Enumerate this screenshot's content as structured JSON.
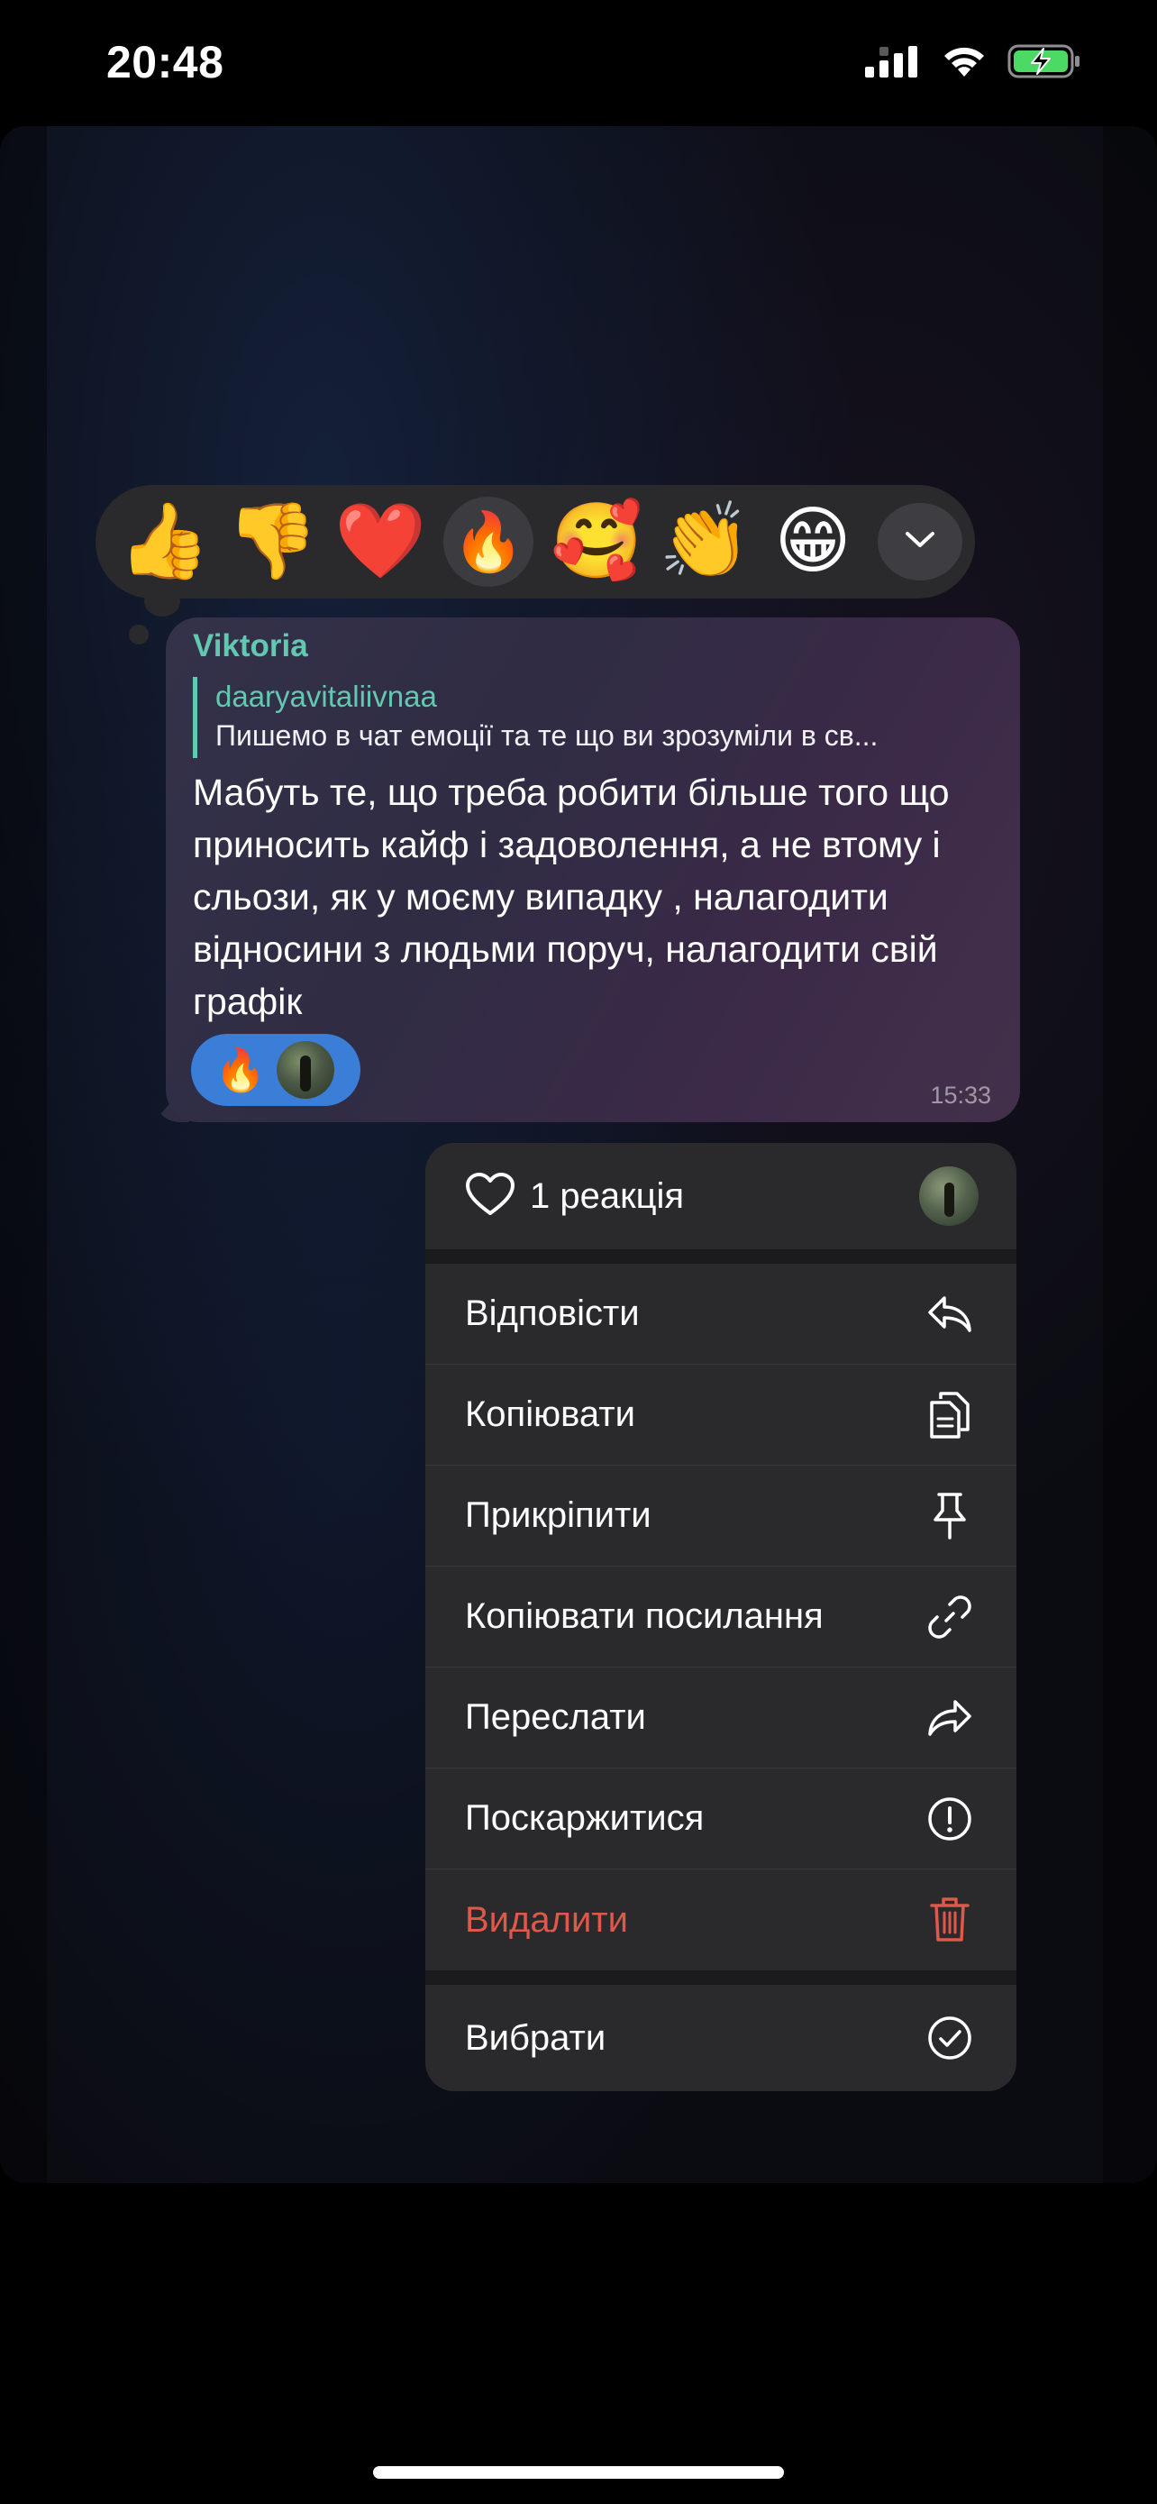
{
  "status_bar": {
    "time": "20:48",
    "signal_icon": "cellular-signal-icon",
    "wifi_icon": "wifi-icon",
    "battery_icon": "battery-charging-icon",
    "battery_color": "#4cd964"
  },
  "reactions": [
    {
      "emoji": "👍",
      "name": "thumbs-up"
    },
    {
      "emoji": "👎",
      "name": "thumbs-down"
    },
    {
      "emoji": "❤️",
      "name": "red-heart"
    },
    {
      "emoji": "🔥",
      "name": "fire",
      "selected": true
    },
    {
      "emoji": "🥰",
      "name": "smiling-face-with-hearts"
    },
    {
      "emoji": "👏",
      "name": "clapping-hands"
    },
    {
      "emoji": "😁",
      "name": "beaming-face"
    }
  ],
  "message": {
    "sender": "Viktoria",
    "reply_author": "daaryavitaliivnaa",
    "reply_text": "Пишемо в чат емоції та те що ви зрозуміли в св...",
    "text": "Мабуть те, що треба робити більше того що приносить кайф і задоволення, а не втому і сльози, як у моєму випадку , налагодити відносини з людьми поруч, налагодити свій графік",
    "reaction_emoji": "🔥",
    "time": "15:33",
    "accent_color": "#63c8b0",
    "reaction_pill_color": "#3a7ed8"
  },
  "menu": {
    "header_label": "1 реакція",
    "header_icon": "heart-outline-icon",
    "items": [
      {
        "label": "Відповісти",
        "icon": "reply-icon"
      },
      {
        "label": "Копіювати",
        "icon": "copy-icon"
      },
      {
        "label": "Прикріпити",
        "icon": "pin-icon"
      },
      {
        "label": "Копіювати посилання",
        "icon": "link-icon"
      },
      {
        "label": "Переслати",
        "icon": "forward-icon"
      },
      {
        "label": "Поскаржитися",
        "icon": "report-icon"
      },
      {
        "label": "Видалити",
        "icon": "trash-icon",
        "destructive": true
      }
    ],
    "select_label": "Вибрати",
    "select_icon": "checkmark-circle-icon",
    "destructive_color": "#e0584a"
  }
}
